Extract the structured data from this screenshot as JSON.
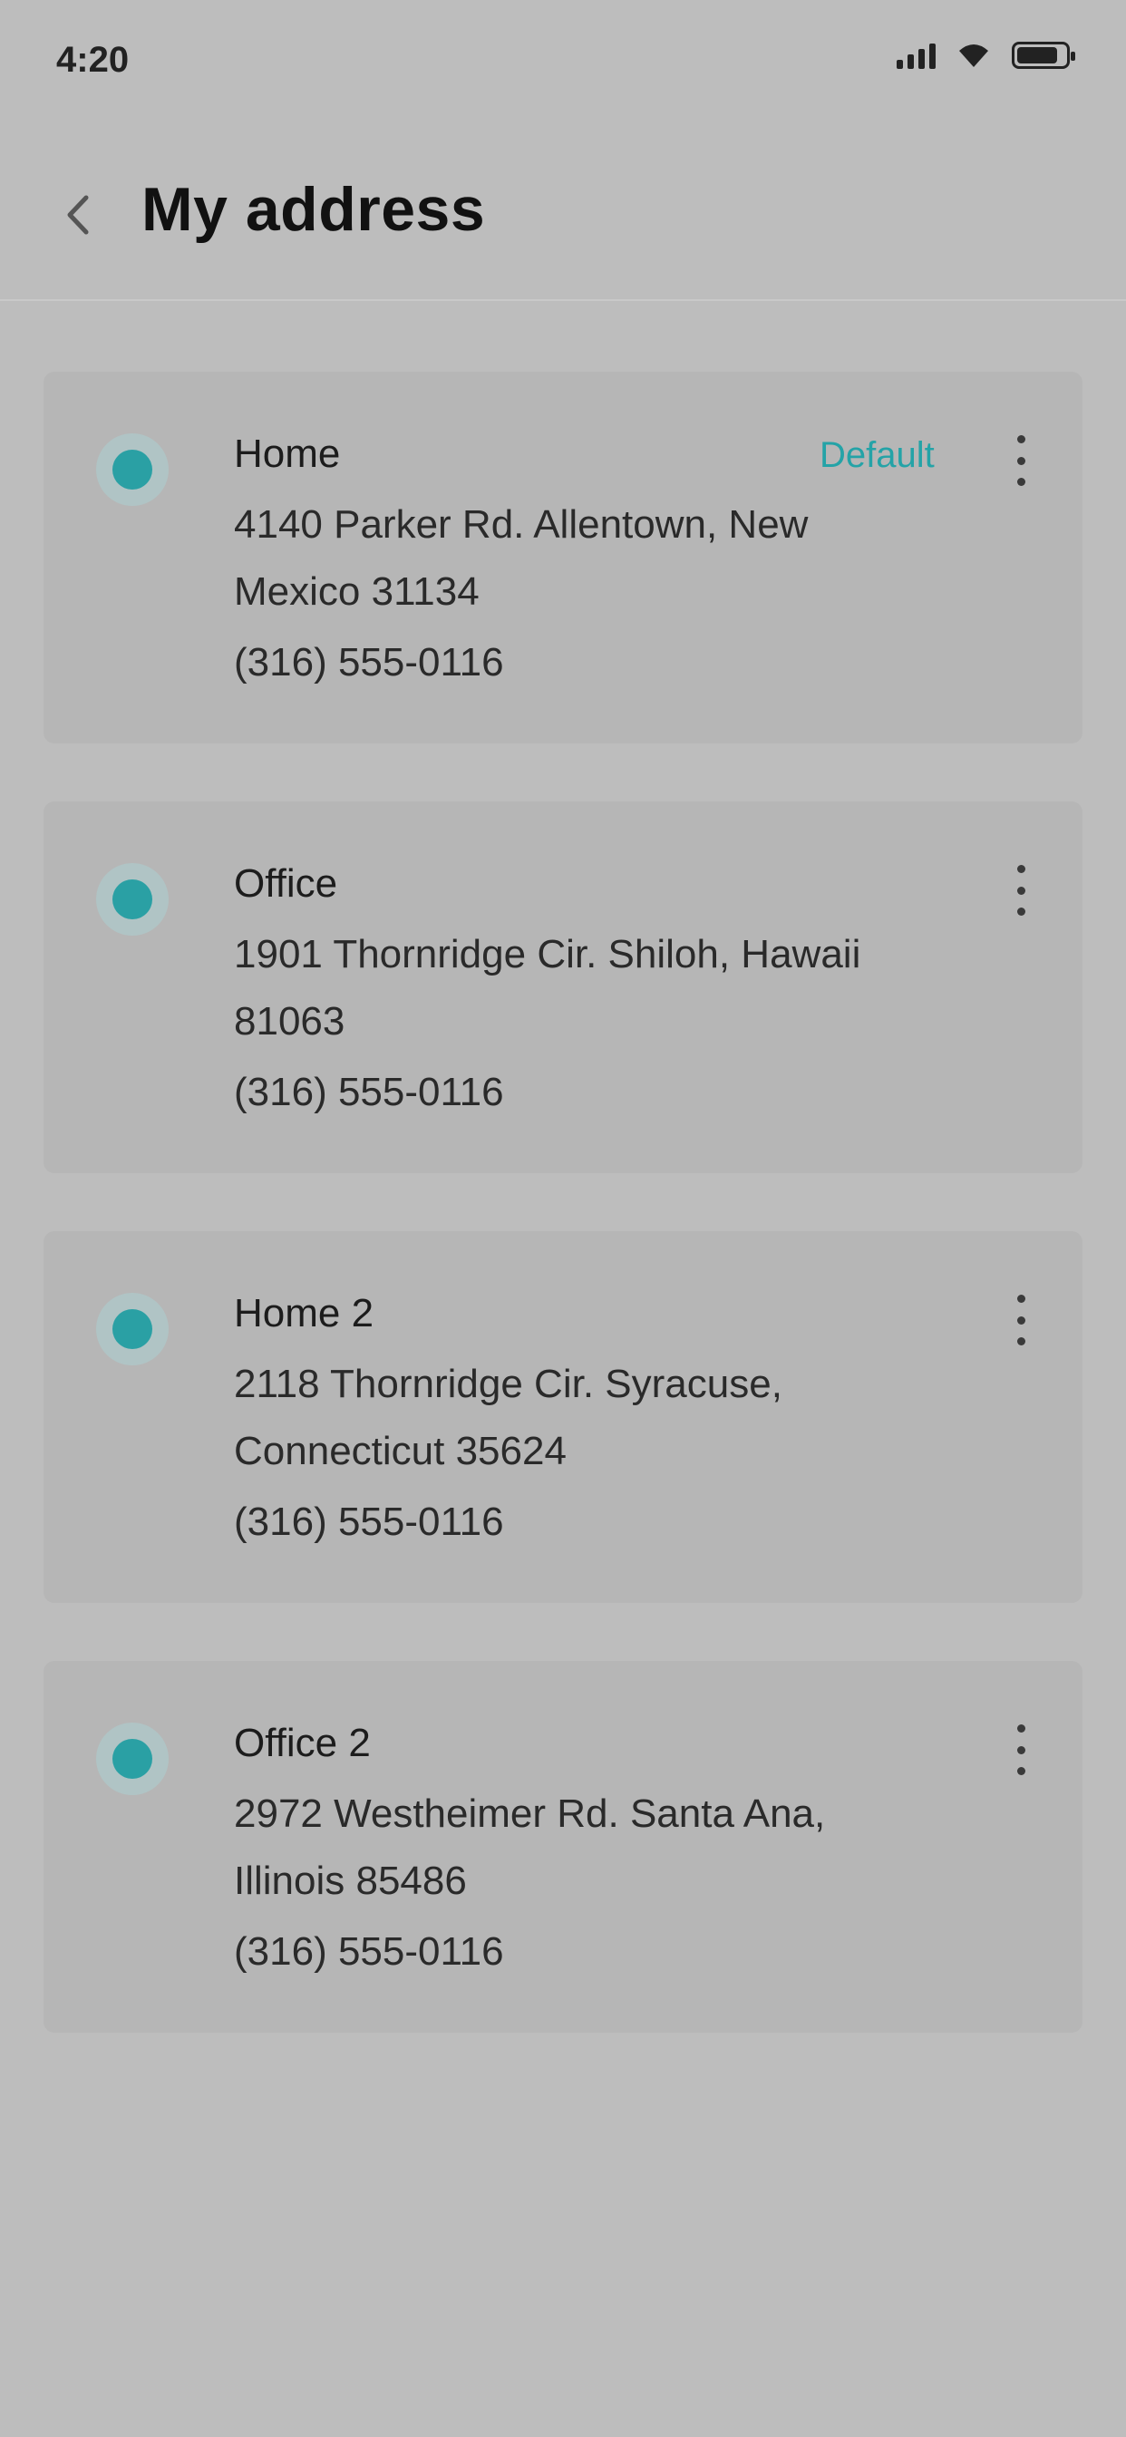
{
  "status": {
    "time": "4:20"
  },
  "header": {
    "title": "My address"
  },
  "addresses": [
    {
      "name": "Home",
      "line": "4140 Parker Rd. Allentown, New Mexico 31134",
      "phone": "(316) 555-0116",
      "badge": "Default"
    },
    {
      "name": "Office",
      "line": "1901 Thornridge Cir. Shiloh, Hawaii 81063",
      "phone": "(316) 555-0116"
    },
    {
      "name": "Home 2",
      "line": "2118 Thornridge Cir. Syracuse, Connecticut 35624",
      "phone": "(316) 555-0116"
    },
    {
      "name": "Office 2",
      "line": "2972 Westheimer Rd. Santa Ana, Illinois 85486",
      "phone": "(316) 555-0116"
    }
  ],
  "colors": {
    "accent": "#24a3a7",
    "background": "#bdbdbd",
    "card": "#b6b6b6"
  },
  "icons": {
    "back": "chevron-left-icon",
    "pin": "location-pin-icon",
    "more": "more-vertical-icon"
  }
}
